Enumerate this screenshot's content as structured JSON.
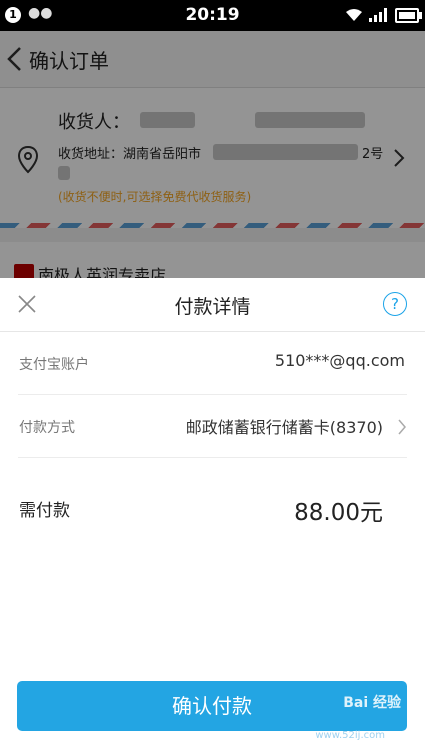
{
  "status_bar": {
    "notification_count": "1",
    "time": "20:19"
  },
  "background_page": {
    "title": "确认订单",
    "recipient_label": "收货人：",
    "address_label": "收货地址：湖南省岳阳市",
    "address_suffix": "2号",
    "delivery_hint": "(收货不便时,可选择免费代收货服务)",
    "shop_name": "南极人英润专卖店"
  },
  "payment_sheet": {
    "title": "付款详情",
    "help_symbol": "?",
    "rows": [
      {
        "label": "支付宝账户",
        "value": "510***@qq.com"
      },
      {
        "label": "付款方式",
        "value": "邮政储蓄银行储蓄卡(8370)"
      }
    ],
    "amount_label": "需付款",
    "amount_value": "88.00元",
    "confirm_label": "确认付款"
  },
  "watermark": {
    "text": "Bai 经验",
    "site": "www.52ij.com"
  },
  "colors": {
    "accent": "#23a5e3",
    "hint": "#f5a623",
    "status_bar": "#000000"
  }
}
